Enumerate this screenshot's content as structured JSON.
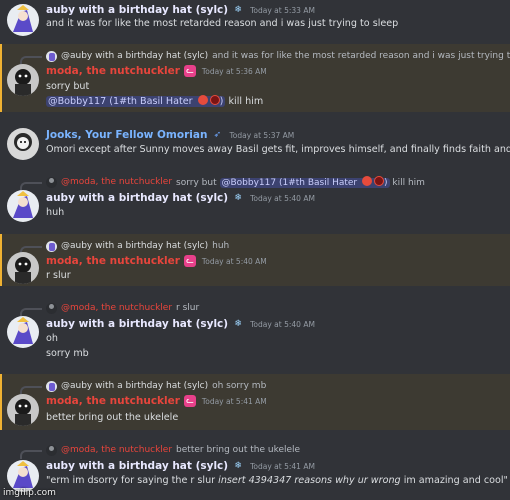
{
  "users": {
    "auby": {
      "name": "auby with a birthday hat (sylc)",
      "color": "#e8e8ff",
      "badge_icon": "snowflake-icon"
    },
    "moda": {
      "name": "moda, the nutchuckler",
      "color": "#e8453c",
      "badge_icon": "pink-cat-icon"
    },
    "jooks": {
      "name": "Jooks, Your Fellow Omorian",
      "color": "#7ab4ff",
      "badge_icon": "paper-plane-icon"
    }
  },
  "messages": [
    {
      "author": "auby with a birthday hat (sylc)",
      "time": "Today at 5:33 AM",
      "lines": [
        "and it was for like the most retarded reason and i was just trying to sleep"
      ]
    },
    {
      "reply_to": {
        "name": "@auby with a birthday hat (sylc)",
        "text": "and it was for like the most retarded reason and i was just trying to sleep"
      },
      "author": "moda, the nutchuckler",
      "time": "Today at 5:36 AM",
      "highlighted": true,
      "lines": [
        "sorry but",
        "kill him"
      ],
      "mention": "@Bobby117 (1#th Basil Hater"
    },
    {
      "author": "Jooks, Your Fellow Omorian",
      "time": "Today at 5:37 AM",
      "lines": [
        "Omori except after Sunny moves away Basil gets fit, improves himself, and finally finds faith and"
      ]
    },
    {
      "reply_to": {
        "name": "@moda, the nutchuckler",
        "text": "sorry but",
        "mention": "@Bobby117 (1#th Basil Hater",
        "after": "kill him"
      },
      "author": "auby with a birthday hat (sylc)",
      "time": "Today at 5:40 AM",
      "lines": [
        "huh"
      ]
    },
    {
      "reply_to": {
        "name": "@auby with a birthday hat (sylc)",
        "text": "huh"
      },
      "author": "moda, the nutchuckler",
      "time": "Today at 5:40 AM",
      "highlighted": true,
      "lines": [
        "r slur"
      ]
    },
    {
      "reply_to": {
        "name": "@moda, the nutchuckler",
        "text": "r slur"
      },
      "author": "auby with a birthday hat (sylc)",
      "time": "Today at 5:40 AM",
      "lines": [
        "oh",
        "sorry mb"
      ]
    },
    {
      "reply_to": {
        "name": "@auby with a birthday hat (sylc)",
        "text": "oh sorry mb"
      },
      "author": "moda, the nutchuckler",
      "time": "Today at 5:41 AM",
      "highlighted": true,
      "lines": [
        "better bring out the ukelele"
      ]
    },
    {
      "reply_to": {
        "name": "@moda, the nutchuckler",
        "text": "better bring out the ukelele"
      },
      "author": "auby with a birthday hat (sylc)",
      "time": "Today at 5:41 AM",
      "lines": [
        "\"erm im dsorry for saying the r slur ",
        "insert 4394347 reasons why ur wrong",
        " im amazing and cool\""
      ]
    }
  ],
  "watermark": "imgflip.com"
}
